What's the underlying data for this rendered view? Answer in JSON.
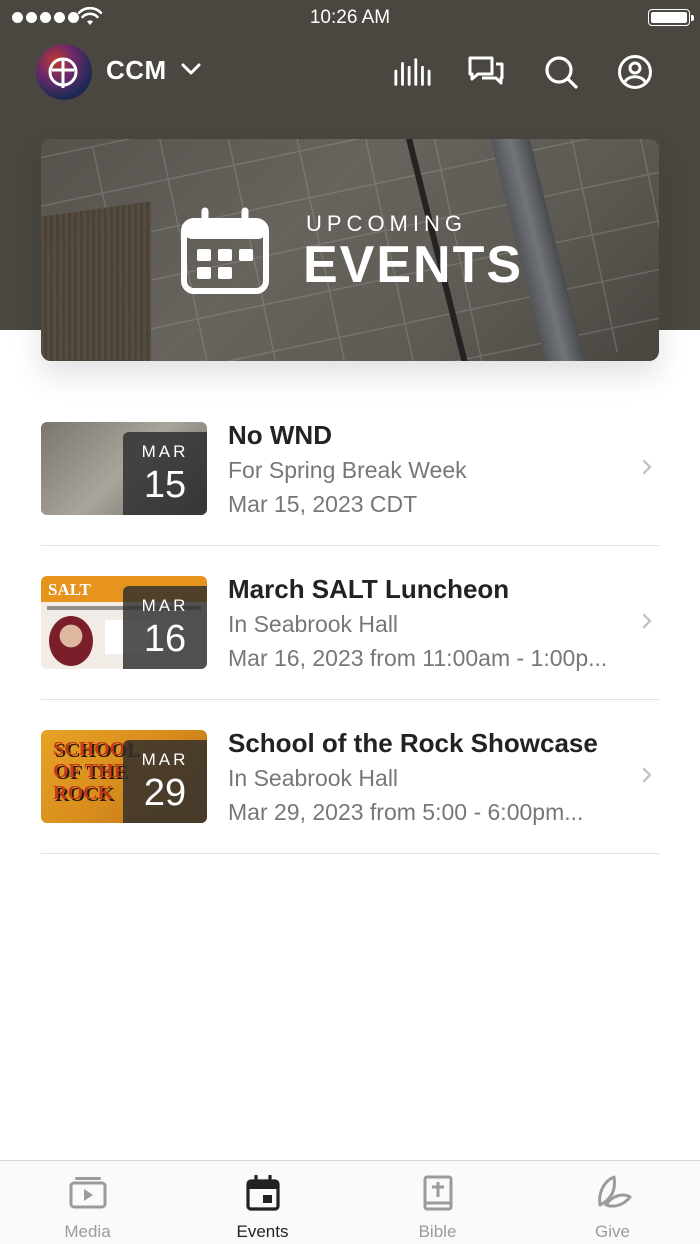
{
  "status_bar": {
    "time": "10:26 AM"
  },
  "header": {
    "org_name": "CCM"
  },
  "hero": {
    "line1": "UPCOMING",
    "line2": "EVENTS"
  },
  "events": [
    {
      "title": "No WND",
      "subtitle": "For Spring Break Week",
      "date": "Mar 15, 2023 CDT",
      "month": "MAR",
      "day": "15"
    },
    {
      "title": "March SALT Luncheon",
      "subtitle": "In Seabrook Hall",
      "date": "Mar 16, 2023 from 11:00am - 1:00p...",
      "month": "MAR",
      "day": "16",
      "thumb_text": "SALT"
    },
    {
      "title": "School of the Rock Showcase",
      "subtitle": "In Seabrook Hall",
      "date": "Mar 29, 2023 from 5:00 - 6:00pm...",
      "month": "MAR",
      "day": "29",
      "thumb_text": "SCHOOL OF THE ROCK"
    }
  ],
  "tabs": [
    {
      "label": "Media",
      "icon": "media-icon",
      "active": false
    },
    {
      "label": "Events",
      "icon": "calendar-icon",
      "active": true
    },
    {
      "label": "Bible",
      "icon": "bible-icon",
      "active": false
    },
    {
      "label": "Give",
      "icon": "give-leaf-icon",
      "active": false
    }
  ],
  "colors": {
    "header_bg": "#4a4740",
    "active_tab": "#222222",
    "inactive_tab": "#9b9b9b"
  }
}
